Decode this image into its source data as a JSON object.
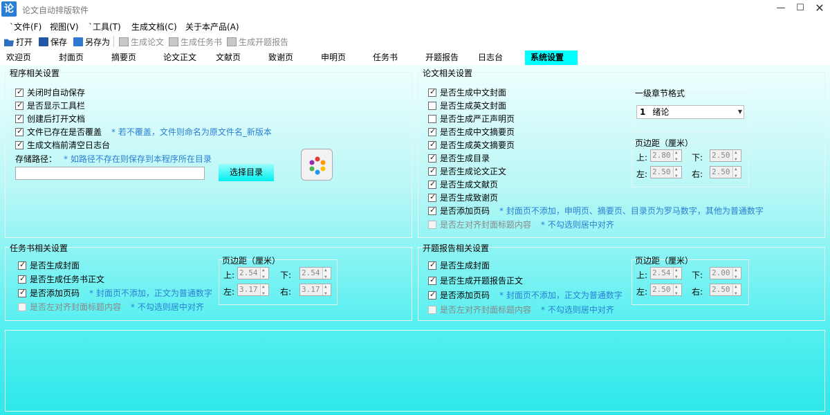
{
  "window": {
    "title": "论文自动排版软件",
    "icon_text": "论"
  },
  "menu": [
    {
      "label": "`文件(F)"
    },
    {
      "label": "视图(V)"
    },
    {
      "label": "`工具(T)"
    },
    {
      "label": "生成文档(C)"
    },
    {
      "label": "关于本产品(A)"
    }
  ],
  "toolbar": {
    "open": "打开",
    "save": "保存",
    "save_as": "另存为",
    "gen_paper": "生成论文",
    "gen_task": "生成任务书",
    "gen_proposal": "生成开题报告"
  },
  "tabs": [
    {
      "label": "欢迎页"
    },
    {
      "label": "封面页"
    },
    {
      "label": "摘要页"
    },
    {
      "label": "论文正文"
    },
    {
      "label": "文献页"
    },
    {
      "label": "致谢页"
    },
    {
      "label": "申明页"
    },
    {
      "label": "任务书"
    },
    {
      "label": "开题报告"
    },
    {
      "label": "日志台"
    },
    {
      "label": "系统设置",
      "active": true
    }
  ],
  "program": {
    "title": "程序相关设置",
    "options": [
      {
        "label": "关闭时自动保存",
        "checked": true
      },
      {
        "label": "是否显示工具栏",
        "checked": true
      },
      {
        "label": "创建后打开文档",
        "checked": true
      },
      {
        "label": "文件已存在是否覆盖",
        "checked": true,
        "hint": "* 若不覆盖，文件则命名为原文件名_新版本"
      },
      {
        "label": "生成文档前清空日志台",
        "checked": true
      }
    ],
    "path_label": "存储路径：",
    "path_hint": "* 如路径不存在则保存到本程序所在目录",
    "path_value": "",
    "select_dir": "选择目录"
  },
  "thesis": {
    "title": "论文相关设置",
    "options": [
      {
        "label": "是否生成中文封面",
        "checked": true
      },
      {
        "label": "是否生成英文封面",
        "checked": false
      },
      {
        "label": "是否生成严正声明页",
        "checked": false
      },
      {
        "label": "是否生成中文摘要页",
        "checked": true
      },
      {
        "label": "是否生成英文摘要页",
        "checked": true
      },
      {
        "label": "是否生成目录",
        "checked": true
      },
      {
        "label": "是否生成论文正文",
        "checked": true
      },
      {
        "label": "是否生成文献页",
        "checked": true
      },
      {
        "label": "是否生成致谢页",
        "checked": true
      },
      {
        "label": "是否添加页码",
        "checked": true,
        "hint": "* 封面页不添加，申明页、摘要页、目录页为罗马数字，其他为普通数字"
      },
      {
        "label": "是否左对齐封面标题内容",
        "checked": false,
        "disabled": true,
        "hint": "* 不勾选则居中对齐"
      }
    ],
    "chapter_format": {
      "title": "一级章节格式",
      "num": "1",
      "value": "绪论"
    },
    "margins": {
      "title": "页边距（厘米）",
      "top_label": "上:",
      "top": "2.80",
      "bottom_label": "下:",
      "bottom": "2.50",
      "left_label": "左:",
      "left": "2.50",
      "right_label": "右:",
      "right": "2.50"
    }
  },
  "task": {
    "title": "任务书相关设置",
    "options": [
      {
        "label": "是否生成封面",
        "checked": true
      },
      {
        "label": "是否生成任务书正文",
        "checked": true
      },
      {
        "label": "是否添加页码",
        "checked": true,
        "hint": "* 封面页不添加，正文为普通数字"
      },
      {
        "label": "是否左对齐封面标题内容",
        "checked": false,
        "hint": "* 不勾选则居中对齐"
      }
    ],
    "margins": {
      "title": "页边距（厘米）",
      "top_label": "上:",
      "top": "2.54",
      "bottom_label": "下:",
      "bottom": "2.54",
      "left_label": "左:",
      "left": "3.17",
      "right_label": "右:",
      "right": "3.17"
    }
  },
  "proposal": {
    "title": "开题报告相关设置",
    "options": [
      {
        "label": "是否生成封面",
        "checked": true
      },
      {
        "label": "是否生成开题报告正文",
        "checked": true
      },
      {
        "label": "是否添加页码",
        "checked": true,
        "hint": "* 封面页不添加，正文为普通数字"
      },
      {
        "label": "是否左对齐封面标题内容",
        "checked": false,
        "hint": "* 不勾选则居中对齐"
      }
    ],
    "margins": {
      "title": "页边距（厘米）",
      "top_label": "上:",
      "top": "2.54",
      "bottom_label": "下:",
      "bottom": "2.00",
      "left_label": "左:",
      "left": "2.50",
      "right_label": "右:",
      "right": "2.50"
    }
  },
  "colors": {
    "accent": "#00ffff",
    "hint": "#2a7fd4",
    "brand": "#2a7fd4"
  }
}
